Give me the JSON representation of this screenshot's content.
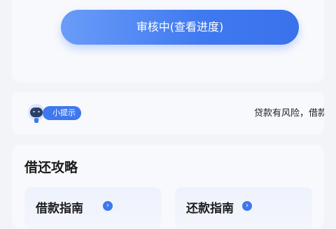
{
  "status_button": {
    "label": "审核中(查看进度)"
  },
  "tip": {
    "badge": "小提示",
    "text": "贷款有风险，借款"
  },
  "guide": {
    "title": "借还攻略",
    "items": [
      {
        "label": "借款指南"
      },
      {
        "label": "还款指南"
      }
    ]
  },
  "colors": {
    "accent": "#3f77ee",
    "background": "#f2f4f8",
    "card": "#f8f9fd"
  },
  "icons": {
    "robot": "robot-assistant-icon",
    "arrow": "chevron-right-circle-icon"
  }
}
